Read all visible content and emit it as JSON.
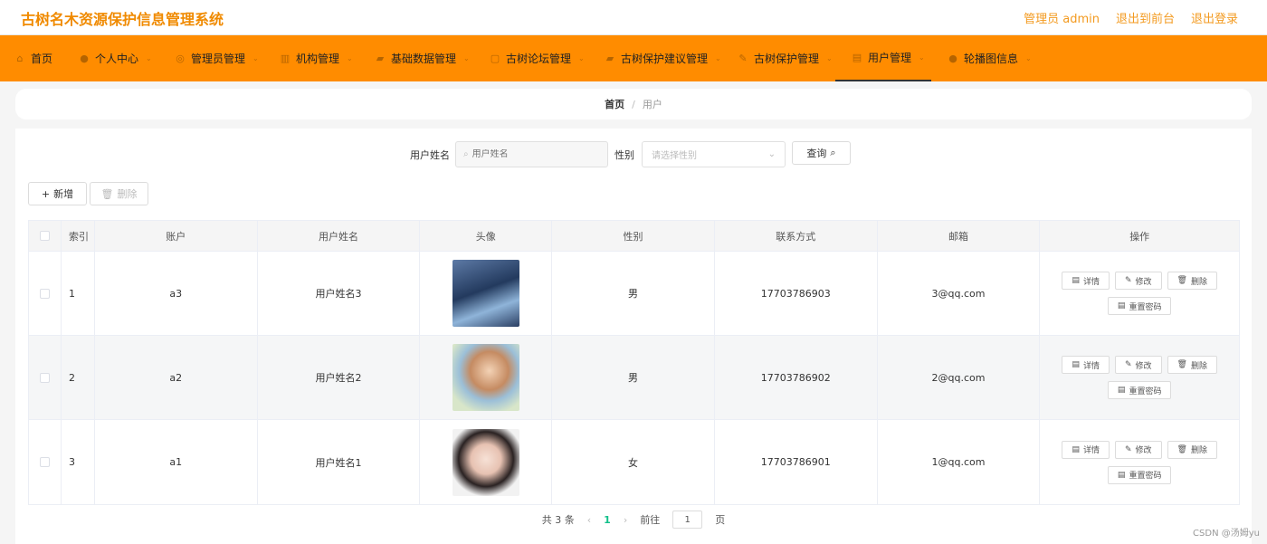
{
  "header": {
    "title": "古树名木资源保护信息管理系统",
    "admin_label": "管理员 admin",
    "back_front": "退出到前台",
    "logout": "退出登录"
  },
  "nav": [
    {
      "label": "首页",
      "icon": "home-icon"
    },
    {
      "label": "个人中心",
      "icon": "user-icon"
    },
    {
      "label": "管理员管理",
      "icon": "compass-icon"
    },
    {
      "label": "机构管理",
      "icon": "chart-icon"
    },
    {
      "label": "基础数据管理",
      "icon": "bag-icon"
    },
    {
      "label": "古树论坛管理",
      "icon": "forum-icon"
    },
    {
      "label": "古树保护建议管理",
      "icon": "bag-icon"
    },
    {
      "label": "古树保护管理",
      "icon": "leaf-icon"
    },
    {
      "label": "用户管理",
      "icon": "list-icon"
    },
    {
      "label": "轮播图信息",
      "icon": "user-icon"
    }
  ],
  "breadcrumb": {
    "home": "首页",
    "sep": "/",
    "current": "用户"
  },
  "search": {
    "name_label": "用户姓名",
    "name_placeholder": "用户姓名",
    "gender_label": "性别",
    "gender_placeholder": "请选择性别",
    "query_btn": "查询"
  },
  "actions": {
    "add": "新增",
    "delete": "删除"
  },
  "table": {
    "headers": [
      "索引",
      "账户",
      "用户姓名",
      "头像",
      "性别",
      "联系方式",
      "邮箱",
      "操作"
    ],
    "rows": [
      {
        "index": "1",
        "account": "a3",
        "name": "用户姓名3",
        "avatar": "avatar-1",
        "gender": "男",
        "phone": "17703786903",
        "email": "3@qq.com"
      },
      {
        "index": "2",
        "account": "a2",
        "name": "用户姓名2",
        "avatar": "avatar-2",
        "gender": "男",
        "phone": "17703786902",
        "email": "2@qq.com"
      },
      {
        "index": "3",
        "account": "a1",
        "name": "用户姓名1",
        "avatar": "avatar-3",
        "gender": "女",
        "phone": "17703786901",
        "email": "1@qq.com"
      }
    ],
    "row_actions": {
      "detail": "详情",
      "edit": "修改",
      "delete": "删除",
      "reset": "重置密码"
    }
  },
  "pager": {
    "total": "共 3 条",
    "current": "1",
    "goto": "前往",
    "page_value": "1",
    "page_unit": "页",
    "prev": "‹",
    "next": "›"
  },
  "watermark": "CSDN @汤姆yu",
  "colors": {
    "accent": "#ff8c00",
    "title": "#f08a00",
    "page_active": "#13c08a"
  }
}
